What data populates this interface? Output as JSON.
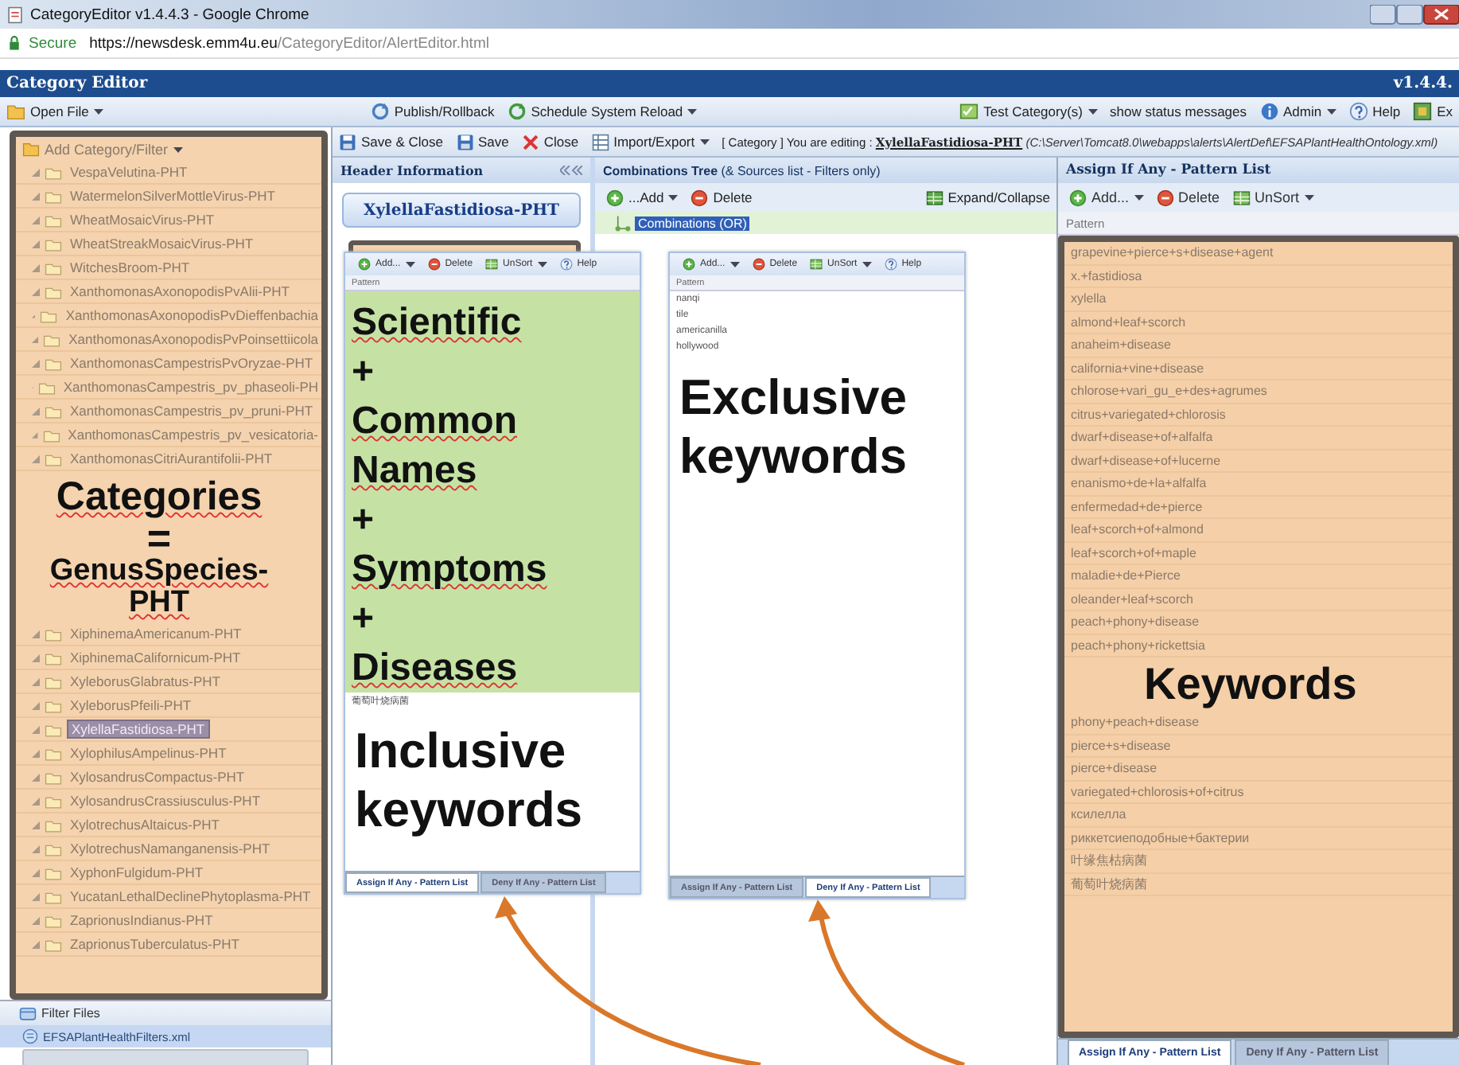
{
  "browser": {
    "title": "CategoryEditor v1.4.4.3 - Google Chrome",
    "secure": "Secure",
    "url_host": "https://newsdesk.emm4u.eu",
    "url_path": "/CategoryEditor/AlertEditor.html"
  },
  "app": {
    "title": "Category Editor",
    "version": "v1.4.4."
  },
  "main_toolbar": {
    "left": [
      {
        "label": "Open File",
        "kind": "folder",
        "dropdown": true
      }
    ],
    "center": [
      {
        "label": "Publish/Rollback",
        "kind": "publish",
        "dropdown": false
      },
      {
        "label": "Schedule System Reload",
        "kind": "reload",
        "dropdown": true
      }
    ],
    "right": [
      {
        "label": "Test Category(s)",
        "kind": "test",
        "dropdown": true
      },
      {
        "label": "show status messages",
        "kind": "plain",
        "dropdown": false
      },
      {
        "label": "Admin",
        "kind": "info",
        "dropdown": true
      },
      {
        "label": "Help",
        "kind": "help",
        "dropdown": false
      },
      {
        "label": "Ex",
        "kind": "exit",
        "dropdown": false
      }
    ]
  },
  "editor_toolbar": {
    "buttons": [
      {
        "label": "Save & Close",
        "kind": "save",
        "dropdown": false
      },
      {
        "label": "Save",
        "kind": "save",
        "dropdown": false
      },
      {
        "label": "Close",
        "kind": "close",
        "dropdown": false
      },
      {
        "label": "Import/Export",
        "kind": "import",
        "dropdown": true
      }
    ],
    "status": "[ Category ] You are editing : **XylellaFastidiosa-PHT** *(C:\\Server\\Tomcat8.0\\webapps\\alerts\\AlertDef\\EFSAPlantHealthOntology.xml)*"
  },
  "category_tree": {
    "menu": "Add Category/Filter",
    "items_top": [
      {
        "label": "VespaVelutina-PHT",
        "selected": false
      },
      {
        "label": "WatermelonSilverMottleVirus-PHT",
        "selected": false
      },
      {
        "label": "WheatMosaicVirus-PHT",
        "selected": false
      },
      {
        "label": "WheatStreakMosaicVirus-PHT",
        "selected": false
      },
      {
        "label": "WitchesBroom-PHT",
        "selected": false
      },
      {
        "label": "XanthomonasAxonopodisPvAlii-PHT",
        "selected": false
      },
      {
        "label": "XanthomonasAxonopodisPvDieffenbachia",
        "selected": false
      },
      {
        "label": "XanthomonasAxonopodisPvPoinsettiicola",
        "selected": false
      },
      {
        "label": "XanthomonasCampestrisPvOryzae-PHT",
        "selected": false
      },
      {
        "label": "XanthomonasCampestris_pv_phaseoli-PH",
        "selected": false
      },
      {
        "label": "XanthomonasCampestris_pv_pruni-PHT",
        "selected": false
      },
      {
        "label": "XanthomonasCampestris_pv_vesicatoria-",
        "selected": false
      },
      {
        "label": "XanthomonasCitriAurantifolii-PHT",
        "selected": false
      }
    ],
    "annotation": [
      "Categories",
      "=",
      "GenusSpecies-PHT"
    ],
    "items_bottom": [
      {
        "label": "XiphinemaAmericanum-PHT",
        "selected": false
      },
      {
        "label": "XiphinemaCalifornicum-PHT",
        "selected": false
      },
      {
        "label": "XyleborusGlabratus-PHT",
        "selected": false
      },
      {
        "label": "XyleborusPfeili-PHT",
        "selected": false
      },
      {
        "label": "XylellaFastidiosa-PHT",
        "selected": true
      },
      {
        "label": "XylophilusAmpelinus-PHT",
        "selected": false
      },
      {
        "label": "XylosandrusCompactus-PHT",
        "selected": false
      },
      {
        "label": "XylosandrusCrassiusculus-PHT",
        "selected": false
      },
      {
        "label": "XylotrechusAltaicus-PHT",
        "selected": false
      },
      {
        "label": "XylotrechusNamanganensis-PHT",
        "selected": false
      },
      {
        "label": "XyphonFulgidum-PHT",
        "selected": false
      },
      {
        "label": "YucatanLethalDeclinePhytoplasma-PHT",
        "selected": false
      },
      {
        "label": "ZaprionusIndianus-PHT",
        "selected": false
      },
      {
        "label": "ZaprionusTuberculatus-PHT",
        "selected": false
      }
    ]
  },
  "filter_files": {
    "title": "Filter Files",
    "items": [
      {
        "label": "EFSAPlantHealthFilters.xml",
        "selected": true
      }
    ]
  },
  "header_panel": {
    "title": "Header Information",
    "category_button": "XylellaFastidiosa-PHT"
  },
  "combinations_panel": {
    "title": "**Combinations Tree** (& Sources list - Filters only)",
    "toolbar": [
      {
        "label": "...Add",
        "kind": "add",
        "dropdown": true
      },
      {
        "label": "Delete",
        "kind": "delete",
        "dropdown": false
      }
    ],
    "expand": {
      "label": "Expand/Collapse",
      "kind": "expand"
    },
    "tree": [
      {
        "label": "Combinations (OR)",
        "selected": true
      }
    ]
  },
  "inclusive_inset": {
    "toolbar": [
      {
        "label": "Add...",
        "kind": "add",
        "dropdown": true
      },
      {
        "label": "Delete",
        "kind": "delete",
        "dropdown": false
      },
      {
        "label": "UnSort",
        "kind": "sort",
        "dropdown": true
      },
      {
        "label": "Help",
        "kind": "help",
        "dropdown": false
      }
    ],
    "column": "Pattern",
    "highlight": [
      "Scientific",
      "+",
      "Common Names",
      "+",
      "Symptoms",
      "+",
      "Diseases"
    ],
    "rows": [
      "葡萄叶烧病菌"
    ],
    "caption": "Inclusive keywords",
    "tabs": [
      {
        "label": "Assign If Any - Pattern List",
        "selected": true
      },
      {
        "label": "Deny If Any - Pattern List",
        "selected": false
      }
    ]
  },
  "exclusive_inset": {
    "toolbar": [
      {
        "label": "Add...",
        "kind": "add",
        "dropdown": true
      },
      {
        "label": "Delete",
        "kind": "delete",
        "dropdown": false
      },
      {
        "label": "UnSort",
        "kind": "sort",
        "dropdown": true
      },
      {
        "label": "Help",
        "kind": "help",
        "dropdown": false
      }
    ],
    "column": "Pattern",
    "rows": [
      "nanqi",
      "tile",
      "americanilla",
      "hollywood"
    ],
    "caption": "Exclusive keywords",
    "tabs": [
      {
        "label": "Assign If Any - Pattern List",
        "selected": false
      },
      {
        "label": "Deny If Any - Pattern List",
        "selected": true
      }
    ]
  },
  "pattern_panel": {
    "title": "Assign If Any - Pattern List",
    "toolbar": [
      {
        "label": "Add...",
        "kind": "add",
        "dropdown": true
      },
      {
        "label": "Delete",
        "kind": "delete",
        "dropdown": false
      },
      {
        "label": "UnSort",
        "kind": "sort",
        "dropdown": true
      }
    ],
    "column": "Pattern",
    "rows_top": [
      "grapevine+pierce+s+disease+agent",
      "x.+fastidiosa",
      "xylella",
      "almond+leaf+scorch",
      "anaheim+disease",
      "california+vine+disease",
      "chlorose+vari_gu_e+des+agrumes",
      "citrus+variegated+chlorosis",
      "dwarf+disease+of+alfalfa",
      "dwarf+disease+of+lucerne",
      "enanismo+de+la+alfalfa",
      "enfermedad+de+pierce",
      "leaf+scorch+of+almond",
      "leaf+scorch+of+maple",
      "maladie+de+Pierce",
      "oleander+leaf+scorch",
      "peach+phony+disease",
      "peach+phony+rickettsia"
    ],
    "annotation": "Keywords",
    "rows_bottom": [
      "phony+peach+disease",
      "pierce+s+disease",
      "pierce+disease",
      "variegated+chlorosis+of+citrus",
      "ксилелла",
      "риккетсиеподобные+бактерии",
      "叶缘焦枯病菌",
      "葡萄叶烧病菌"
    ],
    "tabs": [
      {
        "label": "Assign If Any - Pattern List",
        "selected": true
      },
      {
        "label": "Deny If Any - Pattern List",
        "selected": false
      }
    ]
  }
}
